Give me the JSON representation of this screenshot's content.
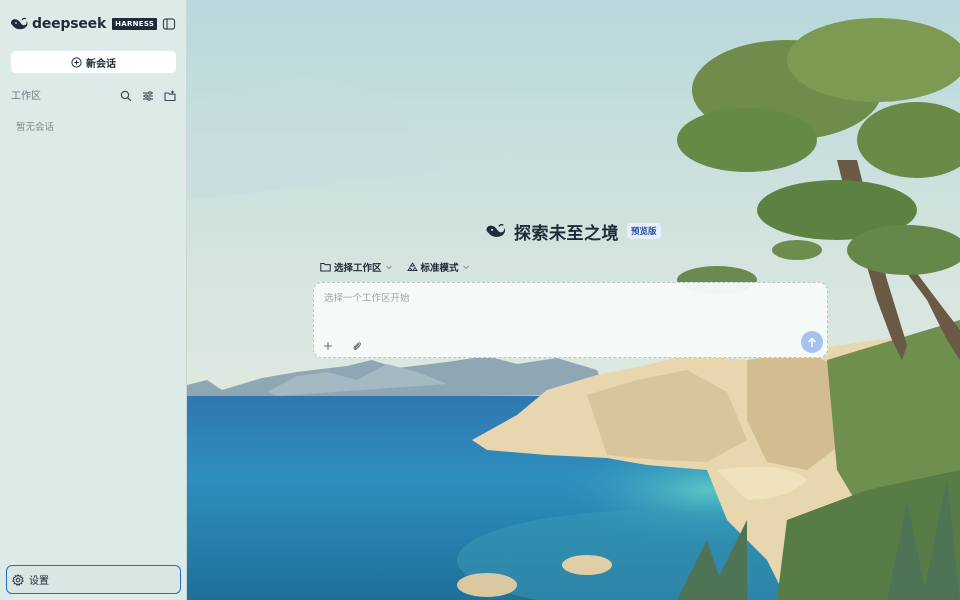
{
  "brand": {
    "name": "deepseek",
    "badge": "HARNESS",
    "logo_icon": "whale-icon"
  },
  "sidebar": {
    "new_chat_label": "新会话",
    "workspace_label": "工作区",
    "empty_label": "暂无会话",
    "settings_label": "设置",
    "tools": [
      "search-icon",
      "filter-icon",
      "add-folder-icon"
    ]
  },
  "hero": {
    "title": "探索未至之境",
    "badge": "预览版"
  },
  "selectors": {
    "workspace": "选择工作区",
    "mode": "标准模式"
  },
  "composer": {
    "placeholder": "选择一个工作区开始"
  },
  "colors": {
    "accent": "#2f6bc5",
    "text": "#1d2b3a",
    "sidebar_bg": "#dcebe7",
    "send_button": "#a8c0ee"
  }
}
